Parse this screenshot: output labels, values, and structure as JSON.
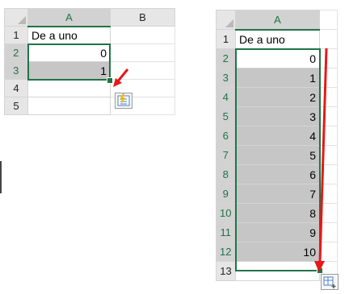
{
  "left_sheet": {
    "columns": [
      "A",
      "B"
    ],
    "rows": [
      {
        "num": "1",
        "a": "De a uno",
        "b": ""
      },
      {
        "num": "2",
        "a": "0",
        "b": ""
      },
      {
        "num": "3",
        "a": "1",
        "b": ""
      },
      {
        "num": "4",
        "a": "",
        "b": ""
      },
      {
        "num": "5",
        "a": "",
        "b": ""
      }
    ]
  },
  "right_sheet": {
    "columns": [
      "A"
    ],
    "rows": [
      {
        "num": "1",
        "a": "De a uno"
      },
      {
        "num": "2",
        "a": "0"
      },
      {
        "num": "3",
        "a": "1"
      },
      {
        "num": "4",
        "a": "2"
      },
      {
        "num": "5",
        "a": "3"
      },
      {
        "num": "6",
        "a": "4"
      },
      {
        "num": "7",
        "a": "5"
      },
      {
        "num": "8",
        "a": "6"
      },
      {
        "num": "9",
        "a": "7"
      },
      {
        "num": "10",
        "a": "8"
      },
      {
        "num": "11",
        "a": "9"
      },
      {
        "num": "12",
        "a": "10"
      },
      {
        "num": "13",
        "a": ""
      }
    ]
  },
  "colors": {
    "excel_green": "#217346",
    "arrow_red": "#e81818",
    "selection_fill": "#c6c6c6"
  },
  "icons": [
    "flash-fill-options-icon",
    "auto-fill-options-icon",
    "red-arrow"
  ]
}
